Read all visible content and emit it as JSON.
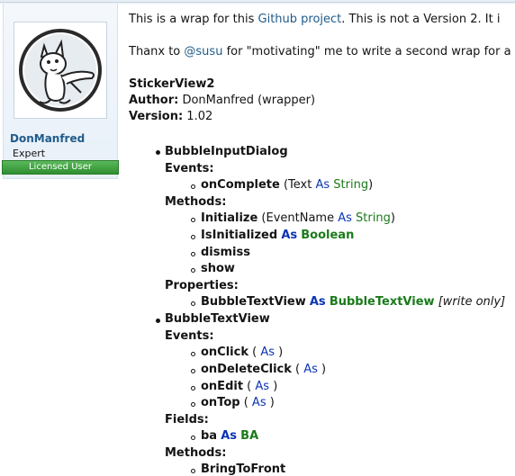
{
  "user": {
    "name": "DonManfred",
    "title": "Expert",
    "badge": "Licensed User"
  },
  "intro": {
    "line1_prefix": "This is a wrap for this ",
    "line1_link": "Github project",
    "line1_suffix": ". This is not a Version 2. It i",
    "line2_prefix": "Thanx to ",
    "line2_link": "@susu",
    "line2_suffix": " for \"motivating\" me to write a second wrap for a"
  },
  "meta": {
    "name": "StickerView2",
    "author_label": "Author:",
    "author_value": " DonManfred (wrapper)",
    "version_label": "Version:",
    "version_value": " 1.02"
  },
  "tree": {
    "cls1": {
      "name": "BubbleInputDialog",
      "events_label": "Events:",
      "ev1_name": "onComplete",
      "ev1_open": " (Text ",
      "ev1_as": "As",
      "ev1_type": "String",
      "ev1_close": ")",
      "methods_label": "Methods:",
      "m1_name": "Initialize",
      "m1_open": " (EventName ",
      "m1_as": "As",
      "m1_type": "String",
      "m1_close": ")",
      "m2_name": "IsInitialized",
      "m2_as": "As",
      "m2_type": "Boolean",
      "m3_name": "dismiss",
      "m4_name": "show",
      "props_label": "Properties:",
      "p1_name": "BubbleTextView",
      "p1_as": "As",
      "p1_type": "BubbleTextView",
      "p1_note": "[write only]"
    },
    "cls2": {
      "name": "BubbleTextView",
      "events_label": "Events:",
      "e1_name": "onClick",
      "e1_open": " ( ",
      "e1_as": "As",
      "e1_close": " )",
      "e2_name": "onDeleteClick",
      "e2_open": " ( ",
      "e2_as": "As",
      "e2_close": " )",
      "e3_name": "onEdit",
      "e3_open": " ( ",
      "e3_as": "As",
      "e3_close": " )",
      "e4_name": "onTop",
      "e4_open": " ( ",
      "e4_as": "As",
      "e4_close": " )",
      "fields_label": "Fields:",
      "f1_name": "ba",
      "f1_as": "As",
      "f1_type": "BA",
      "methods_label": "Methods:",
      "m1_name": "BringToFront"
    }
  }
}
